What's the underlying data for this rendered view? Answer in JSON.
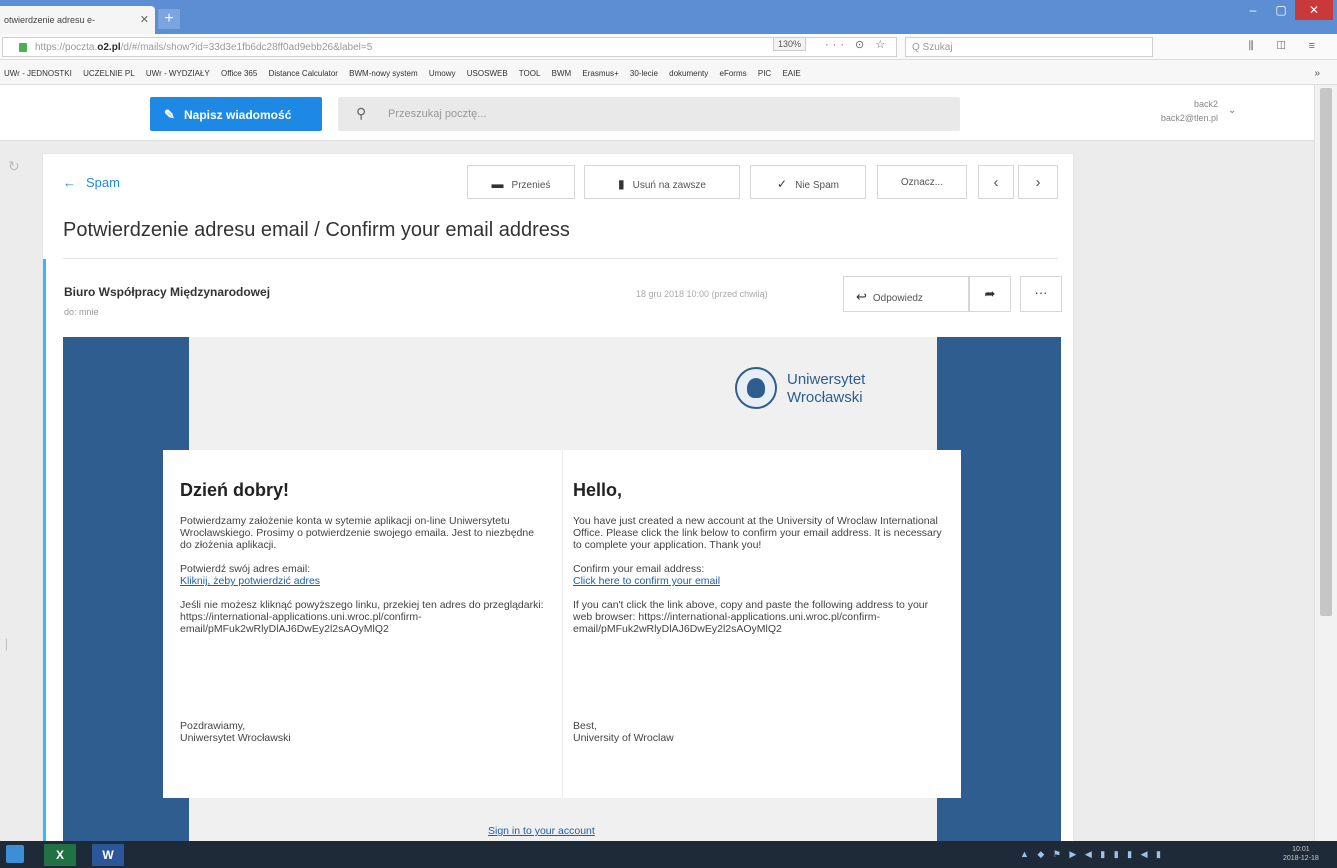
{
  "browser": {
    "tab_title": "otwierdzenie adresu e-",
    "tab_close": "✕",
    "new_tab": "+",
    "url_prefix": "https://poczta.",
    "url_domain": "o2.pl",
    "url_rest": "/d/#/mails/show?id=33d3e1fb6dc28ff0ad9ebb26&label=5",
    "zoom": "130%",
    "url_icons": "··· ⊙ ☆",
    "search_placeholder": "Q Szukaj",
    "nav_icons": "⫼ ◫ ≡",
    "window_buttons": [
      "–",
      "▢",
      "✕"
    ]
  },
  "bookmarks": [
    "UWr - JEDNOSTKI",
    "UCZELNIE PL",
    "UWr - WYDZIAŁY",
    "Office 365",
    "Distance Calculator",
    "BWM-nowy system",
    "Umowy",
    "USOSWEB",
    "TOOL",
    "BWM",
    "Erasmus+",
    "30-lecie",
    "dokumenty",
    "eForms",
    "PIC",
    "EAIE"
  ],
  "bookmarks_more": "»",
  "mail_header": {
    "compose_label": "Napisz wiadomość",
    "search_placeholder": "Przeszukaj pocztę...",
    "account_name": "back2",
    "account_email": "back2@tlen.pl"
  },
  "toolbar": {
    "back_label": "Spam",
    "move_label": "Przenieś",
    "delete_label": "Usuń na zawsze",
    "not_spam_label": "Nie Spam",
    "mark_label": "Oznacz...",
    "prev": "‹",
    "next": "›"
  },
  "message": {
    "subject": "Potwierdzenie adresu email / Confirm your email address",
    "sender": "Biuro Współpracy Międzynarodowej",
    "to_line": "do: mnie",
    "date": "18 gru 2018 10:00 (przed chwilą)",
    "reply_label": "Odpowiedz",
    "more": "···"
  },
  "email": {
    "logo_line1": "Uniwersytet",
    "logo_line2": "Wrocławski",
    "pl": {
      "greeting": "Dzień dobry!",
      "intro": "Potwierdzamy założenie konta w sytemie aplikacji on-line Uniwersytetu Wrocławskiego. Prosimy o potwierdzenie swojego emaila. Jest to niezbędne do złożenia aplikacji.",
      "confirm_prompt": "Potwierdź swój adres email:",
      "confirm_link": "Kliknij, żeby potwierdzić adres",
      "fallback": "Jeśli nie możesz kliknąć powyższego linku, przekiej ten adres do przeglądarki: https://international-applications.uni.wroc.pl/confirm-email/pMFuk2wRlyDlAJ6DwEy2l2sAOyMlQ2",
      "sign_line1": "Pozdrawiamy,",
      "sign_line2": "Uniwersytet Wrocławski"
    },
    "en": {
      "greeting": "Hello,",
      "intro": "You have just created a new account at the University of Wroclaw International Office. Please click the link below to confirm your email address. It is necessary to complete your application. Thank you!",
      "confirm_prompt": "Confirm your email address:",
      "confirm_link": "Click here to confirm your email",
      "fallback": "If you can't click the link above, copy and paste the following address to your web browser: https://international-applications.uni.wroc.pl/confirm-email/pMFuk2wRlyDlAJ6DwEy2l2sAOyMlQ2",
      "sign_line1": "Best,",
      "sign_line2": "University of Wroclaw"
    },
    "signin_link": "Sign in to your account"
  },
  "taskbar": {
    "excel_label": "X",
    "word_label": "W",
    "tray_text": "▲ ◆ ⚑ ▶ ◀ ▮ ▮ ▮ ◀ ▮",
    "clock_time": "10:01",
    "clock_date": "2018-12-18"
  },
  "colors": {
    "accent": "#1e88e5",
    "band": "#2f5d90",
    "selected_border": "#3ab7f4"
  }
}
